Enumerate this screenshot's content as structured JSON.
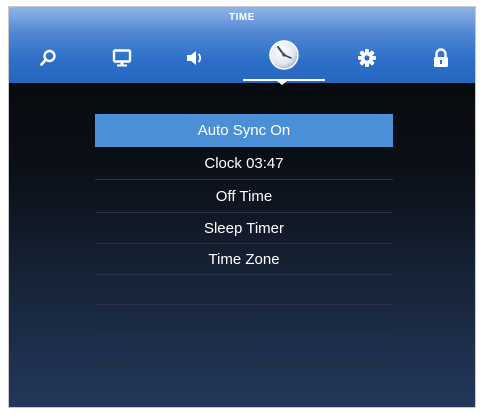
{
  "header": {
    "title": "TIME",
    "tabs": [
      {
        "icon": "search-icon",
        "active": false
      },
      {
        "icon": "monitor-icon",
        "active": false
      },
      {
        "icon": "speaker-icon",
        "active": false
      },
      {
        "icon": "clock-icon",
        "active": true
      },
      {
        "icon": "gear-icon",
        "active": false
      },
      {
        "icon": "lock-icon",
        "active": false
      }
    ]
  },
  "menu": {
    "items": [
      {
        "label": "Auto Sync On",
        "selected": true
      },
      {
        "label": "Clock 03:47",
        "selected": false
      },
      {
        "label": "Off Time",
        "selected": false
      },
      {
        "label": "Sleep Timer",
        "selected": false
      },
      {
        "label": "Time Zone",
        "selected": false
      }
    ]
  },
  "colors": {
    "highlight": "#4b8fd6",
    "header_blue": "#2d6fc8",
    "background_dark": "#060606"
  }
}
